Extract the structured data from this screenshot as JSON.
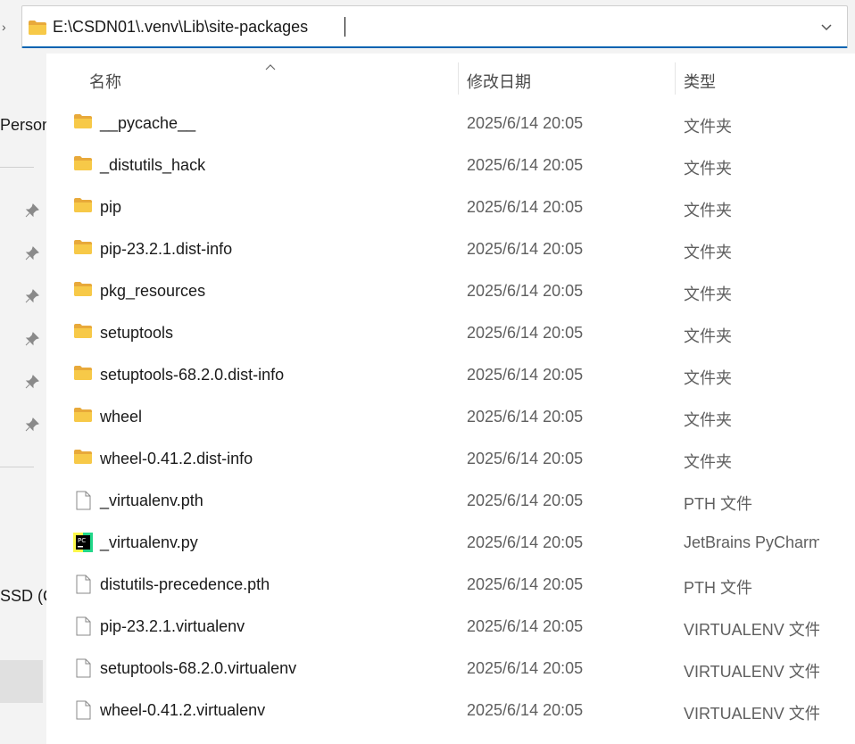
{
  "address_bar": {
    "path": "E:\\CSDN01\\.venv\\Lib\\site-packages"
  },
  "nav_pane": {
    "items": [
      "Person",
      "SSD (C"
    ]
  },
  "columns": {
    "name": "名称",
    "date": "修改日期",
    "type": "类型"
  },
  "rows": [
    {
      "name": "__pycache__",
      "date": "2025/6/14 20:05",
      "type": "文件夹",
      "icon": "folder-icon"
    },
    {
      "name": "_distutils_hack",
      "date": "2025/6/14 20:05",
      "type": "文件夹",
      "icon": "folder-icon"
    },
    {
      "name": "pip",
      "date": "2025/6/14 20:05",
      "type": "文件夹",
      "icon": "folder-icon"
    },
    {
      "name": "pip-23.2.1.dist-info",
      "date": "2025/6/14 20:05",
      "type": "文件夹",
      "icon": "folder-icon"
    },
    {
      "name": "pkg_resources",
      "date": "2025/6/14 20:05",
      "type": "文件夹",
      "icon": "folder-icon"
    },
    {
      "name": "setuptools",
      "date": "2025/6/14 20:05",
      "type": "文件夹",
      "icon": "folder-icon"
    },
    {
      "name": "setuptools-68.2.0.dist-info",
      "date": "2025/6/14 20:05",
      "type": "文件夹",
      "icon": "folder-icon"
    },
    {
      "name": "wheel",
      "date": "2025/6/14 20:05",
      "type": "文件夹",
      "icon": "folder-icon"
    },
    {
      "name": "wheel-0.41.2.dist-info",
      "date": "2025/6/14 20:05",
      "type": "文件夹",
      "icon": "folder-icon"
    },
    {
      "name": "_virtualenv.pth",
      "date": "2025/6/14 20:05",
      "type": "PTH 文件",
      "icon": "file-icon"
    },
    {
      "name": "_virtualenv.py",
      "date": "2025/6/14 20:05",
      "type": "JetBrains PyCharm",
      "icon": "pycharm-icon"
    },
    {
      "name": "distutils-precedence.pth",
      "date": "2025/6/14 20:05",
      "type": "PTH 文件",
      "icon": "file-icon"
    },
    {
      "name": "pip-23.2.1.virtualenv",
      "date": "2025/6/14 20:05",
      "type": "VIRTUALENV 文件",
      "icon": "file-icon"
    },
    {
      "name": "setuptools-68.2.0.virtualenv",
      "date": "2025/6/14 20:05",
      "type": "VIRTUALENV 文件",
      "icon": "file-icon"
    },
    {
      "name": "wheel-0.41.2.virtualenv",
      "date": "2025/6/14 20:05",
      "type": "VIRTUALENV 文件",
      "icon": "file-icon"
    }
  ],
  "colors": {
    "folder": "#f7c948",
    "accent": "#0063b1"
  },
  "icons": [
    "folder-icon",
    "file-icon",
    "pycharm-icon",
    "pin-icon",
    "chevron-down-icon",
    "sort-ascending-icon",
    "back-arrow-icon"
  ]
}
